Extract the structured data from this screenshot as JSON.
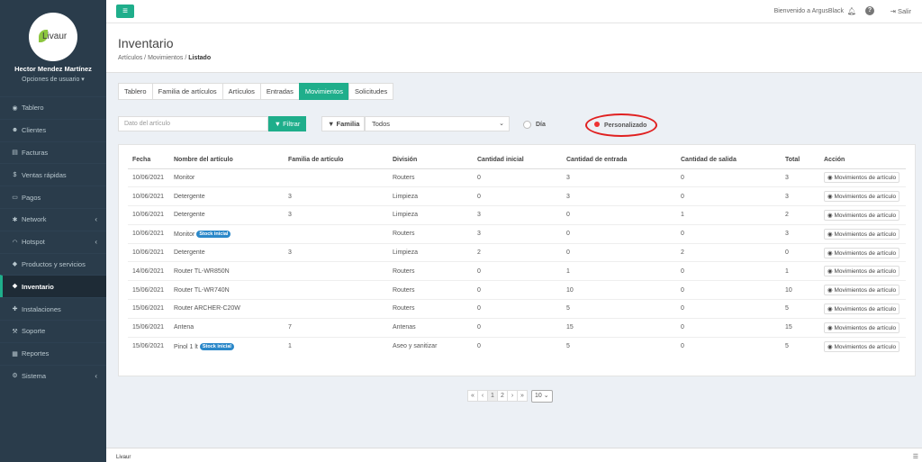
{
  "brand": {
    "logo_text": "Livaur",
    "accent": "#1fae8b"
  },
  "user": {
    "name": "Hector Mendez Martínez",
    "options": "Opciones de usuario ▾"
  },
  "sidebar": {
    "items": [
      {
        "label": "Tablero",
        "icon": "dashboard-icon",
        "chevron": false
      },
      {
        "label": "Clientes",
        "icon": "users-icon",
        "chevron": false
      },
      {
        "label": "Facturas",
        "icon": "file-icon",
        "chevron": false
      },
      {
        "label": "Ventas rápidas",
        "icon": "dollar-icon",
        "chevron": false
      },
      {
        "label": "Pagos",
        "icon": "money-icon",
        "chevron": false
      },
      {
        "label": "Network",
        "icon": "network-icon",
        "chevron": true
      },
      {
        "label": "Hotspot",
        "icon": "wifi-icon",
        "chevron": true
      },
      {
        "label": "Productos y servicios",
        "icon": "tags-icon",
        "chevron": false
      },
      {
        "label": "Inventario",
        "icon": "cubes-icon",
        "chevron": false,
        "active": true
      },
      {
        "label": "Instalaciones",
        "icon": "puzzle-icon",
        "chevron": false
      },
      {
        "label": "Soporte",
        "icon": "wrench-icon",
        "chevron": false
      },
      {
        "label": "Reportes",
        "icon": "chart-icon",
        "chevron": false
      },
      {
        "label": "Sistema",
        "icon": "cogs-icon",
        "chevron": true
      }
    ]
  },
  "topbar": {
    "welcome": "Bienvenido a ArgusBlack",
    "logout": "Salir"
  },
  "page": {
    "title": "Inventario",
    "breadcrumb": [
      "Artículos",
      "Movimientos",
      "Listado"
    ]
  },
  "tabs": [
    "Tablero",
    "Familia de artículos",
    "Artículos",
    "Entradas",
    "Movimientos",
    "Solicitudes"
  ],
  "active_tab": "Movimientos",
  "filters": {
    "search_placeholder": "Dato del artículo",
    "filter_button": "Filtrar",
    "family_label": "Familia",
    "family_value": "Todos",
    "radio_day": "Día",
    "radio_custom": "Personalizado",
    "selected": "Personalizado"
  },
  "table": {
    "columns": [
      "Fecha",
      "Nombre del artículo",
      "Familia de artículo",
      "División",
      "Cantidad inicial",
      "Cantidad de entrada",
      "Cantidad de salida",
      "Total",
      "Acción"
    ],
    "action_label": "Movimientos de artículo",
    "rows": [
      {
        "fecha": "10/06/2021",
        "nombre": "Monitor",
        "badge": "",
        "familia": "",
        "division": "Routers",
        "inicial": "0",
        "entrada": "3",
        "salida": "0",
        "total": "3"
      },
      {
        "fecha": "10/06/2021",
        "nombre": "Detergente",
        "badge": "",
        "familia": "3",
        "division": "Limpieza",
        "inicial": "0",
        "entrada": "3",
        "salida": "0",
        "total": "3"
      },
      {
        "fecha": "10/06/2021",
        "nombre": "Detergente",
        "badge": "",
        "familia": "3",
        "division": "Limpieza",
        "inicial": "3",
        "entrada": "0",
        "salida": "1",
        "total": "2"
      },
      {
        "fecha": "10/06/2021",
        "nombre": "Monitor",
        "badge": "Stock inicial",
        "familia": "",
        "division": "Routers",
        "inicial": "3",
        "entrada": "0",
        "salida": "0",
        "total": "3"
      },
      {
        "fecha": "10/06/2021",
        "nombre": "Detergente",
        "badge": "",
        "familia": "3",
        "division": "Limpieza",
        "inicial": "2",
        "entrada": "0",
        "salida": "2",
        "total": "0"
      },
      {
        "fecha": "14/06/2021",
        "nombre": "Router TL-WR850N",
        "badge": "",
        "familia": "",
        "division": "Routers",
        "inicial": "0",
        "entrada": "1",
        "salida": "0",
        "total": "1"
      },
      {
        "fecha": "15/06/2021",
        "nombre": "Router TL-WR740N",
        "badge": "",
        "familia": "",
        "division": "Routers",
        "inicial": "0",
        "entrada": "10",
        "salida": "0",
        "total": "10"
      },
      {
        "fecha": "15/06/2021",
        "nombre": "Router ARCHER-C20W",
        "badge": "",
        "familia": "",
        "division": "Routers",
        "inicial": "0",
        "entrada": "5",
        "salida": "0",
        "total": "5"
      },
      {
        "fecha": "15/06/2021",
        "nombre": "Antena",
        "badge": "",
        "familia": "7",
        "division": "Antenas",
        "inicial": "0",
        "entrada": "15",
        "salida": "0",
        "total": "15"
      },
      {
        "fecha": "15/06/2021",
        "nombre": "Pinol 1 lt",
        "badge": "Stock inicial",
        "familia": "1",
        "division": "Aseo y sanitizar",
        "inicial": "0",
        "entrada": "5",
        "salida": "0",
        "total": "5"
      }
    ]
  },
  "pagination": {
    "items": [
      "«",
      "‹",
      "1",
      "2",
      "›",
      "»"
    ],
    "active": "1",
    "page_size": "10"
  },
  "footer": {
    "text": "Livaur"
  }
}
